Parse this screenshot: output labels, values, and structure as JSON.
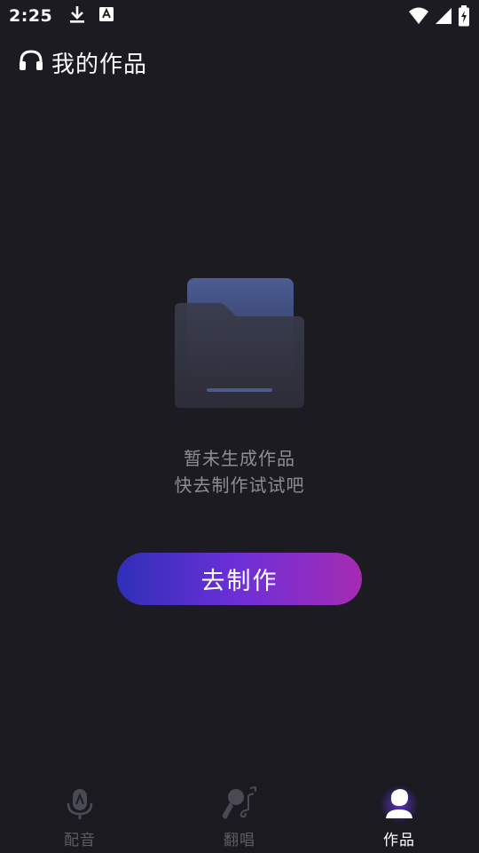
{
  "status_bar": {
    "time": "2:25",
    "icons": [
      "download-icon",
      "accessibility-a-icon",
      "wifi-icon",
      "signal-icon",
      "battery-charging-icon"
    ]
  },
  "header": {
    "icon": "headphones-icon",
    "title": "我的作品"
  },
  "empty_state": {
    "icon": "empty-folder-illustration",
    "line1": "暂未生成作品",
    "line2": "快去制作试试吧"
  },
  "create_button": {
    "label": "去制作"
  },
  "bottom_nav": {
    "items": [
      {
        "label": "配音",
        "icon": "microphone-icon",
        "active": false
      },
      {
        "label": "翻唱",
        "icon": "karaoke-mic-icon",
        "active": false
      },
      {
        "label": "作品",
        "icon": "user-icon",
        "active": true
      }
    ]
  },
  "colors": {
    "background": "#1b1b21",
    "text_muted": "#8d8d95",
    "nav_inactive": "#5d5d66",
    "button_gradient_start": "#2e2fb6",
    "button_gradient_mid": "#6e2fd8",
    "button_gradient_end": "#a52bb2",
    "active_glow": "#6a35e8"
  }
}
